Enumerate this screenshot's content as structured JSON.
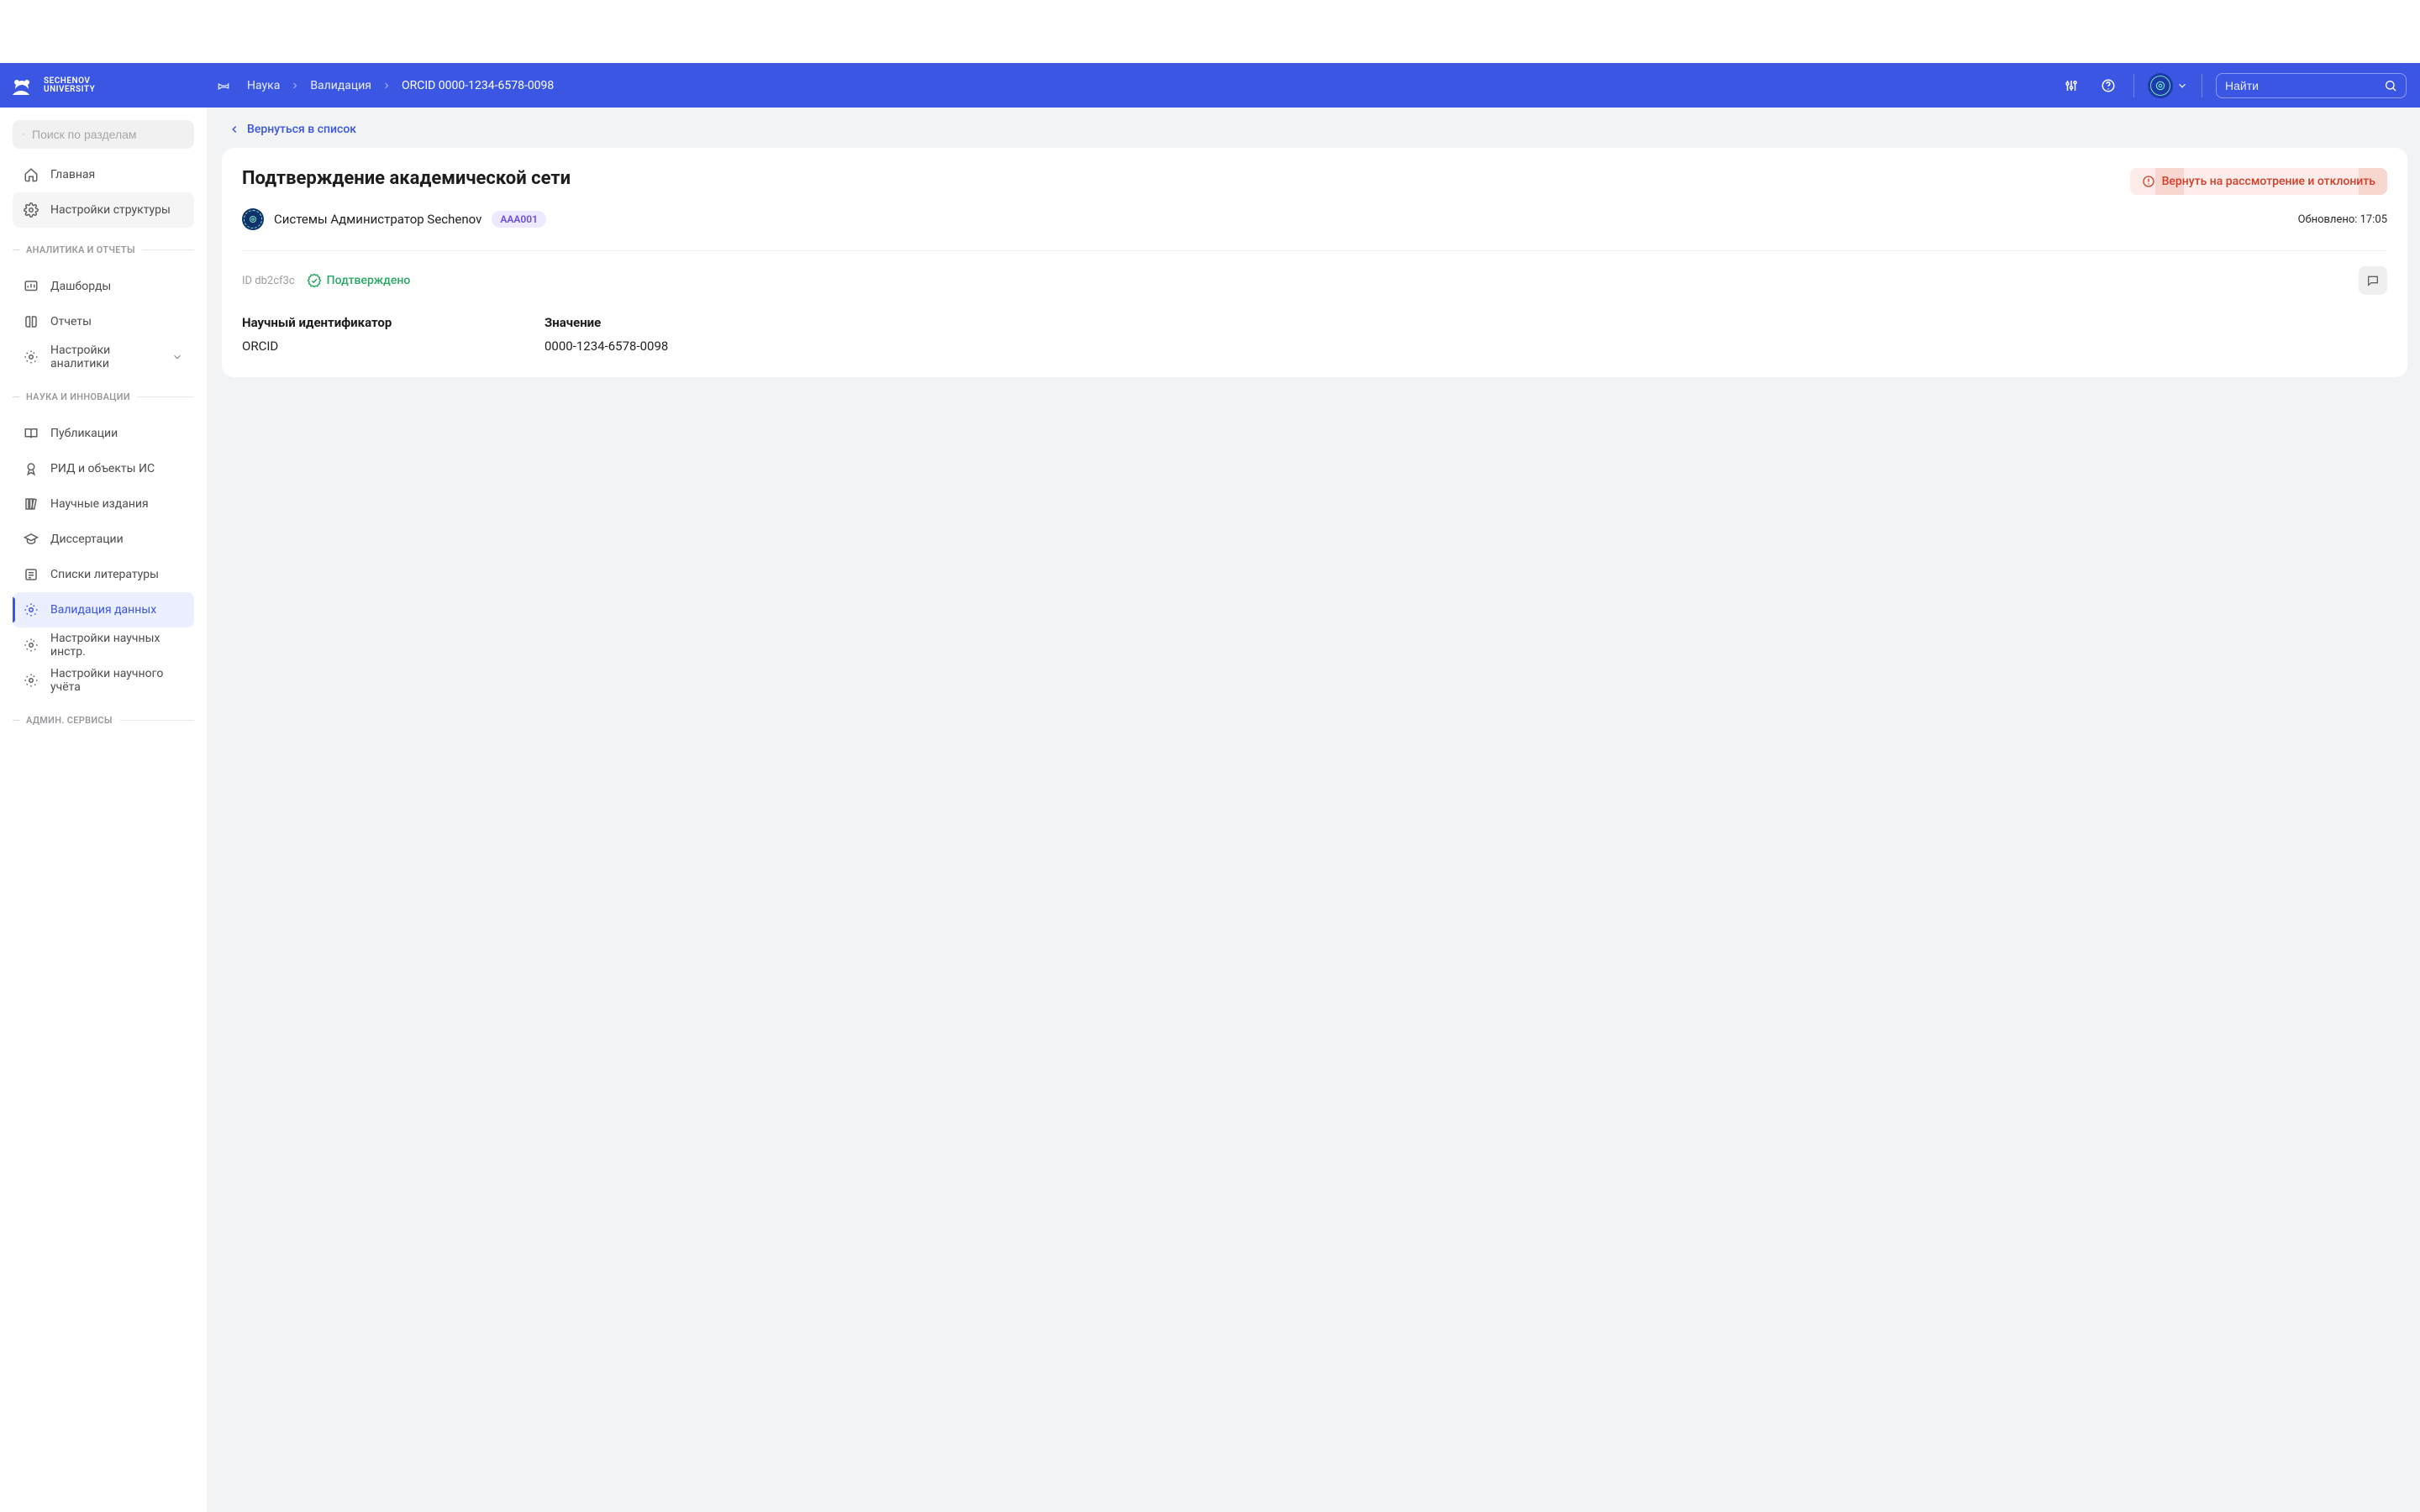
{
  "header": {
    "brand_line1": "SECHENOV",
    "brand_line2": "UNIVERSITY",
    "breadcrumbs": [
      "Наука",
      "Валидация",
      "ORCID 0000-1234-6578-0098"
    ],
    "search_placeholder": "Найти"
  },
  "sidebar": {
    "search_placeholder": "Поиск по разделам",
    "top_items": [
      {
        "label": "Главная"
      },
      {
        "label": "Настройки структуры"
      }
    ],
    "groups": [
      {
        "title": "АНАЛИТИКА И ОТЧЕТЫ",
        "items": [
          {
            "label": "Дашборды"
          },
          {
            "label": "Отчеты"
          },
          {
            "label": "Настройки аналитики",
            "expandable": true
          }
        ]
      },
      {
        "title": "НАУКА И ИННОВАЦИИ",
        "items": [
          {
            "label": "Публикации"
          },
          {
            "label": "РИД и объекты ИС"
          },
          {
            "label": "Научные издания"
          },
          {
            "label": "Диссертации"
          },
          {
            "label": "Списки литературы"
          },
          {
            "label": "Валидация данных",
            "active": true
          },
          {
            "label": "Настройки научных инстр."
          },
          {
            "label": "Настройки научного учёта"
          }
        ]
      },
      {
        "title": "АДМИН. СЕРВИСЫ",
        "items": []
      }
    ]
  },
  "content": {
    "back_label": "Вернуться в список",
    "page_title": "Подтверждение академической сети",
    "action_label": "Вернуть на рассмотрение и отклонить",
    "user_name": "Системы Администратор Sechenov",
    "badge": "AAA001",
    "updated": "Обновлено: 17:05",
    "id_text": "ID db2cf3c",
    "status_text": "Подтверждено",
    "kv": {
      "key1": "Научный идентификатор",
      "key2": "Значение",
      "val1": "ORCID",
      "val2": "0000-1234-6578-0098"
    }
  }
}
